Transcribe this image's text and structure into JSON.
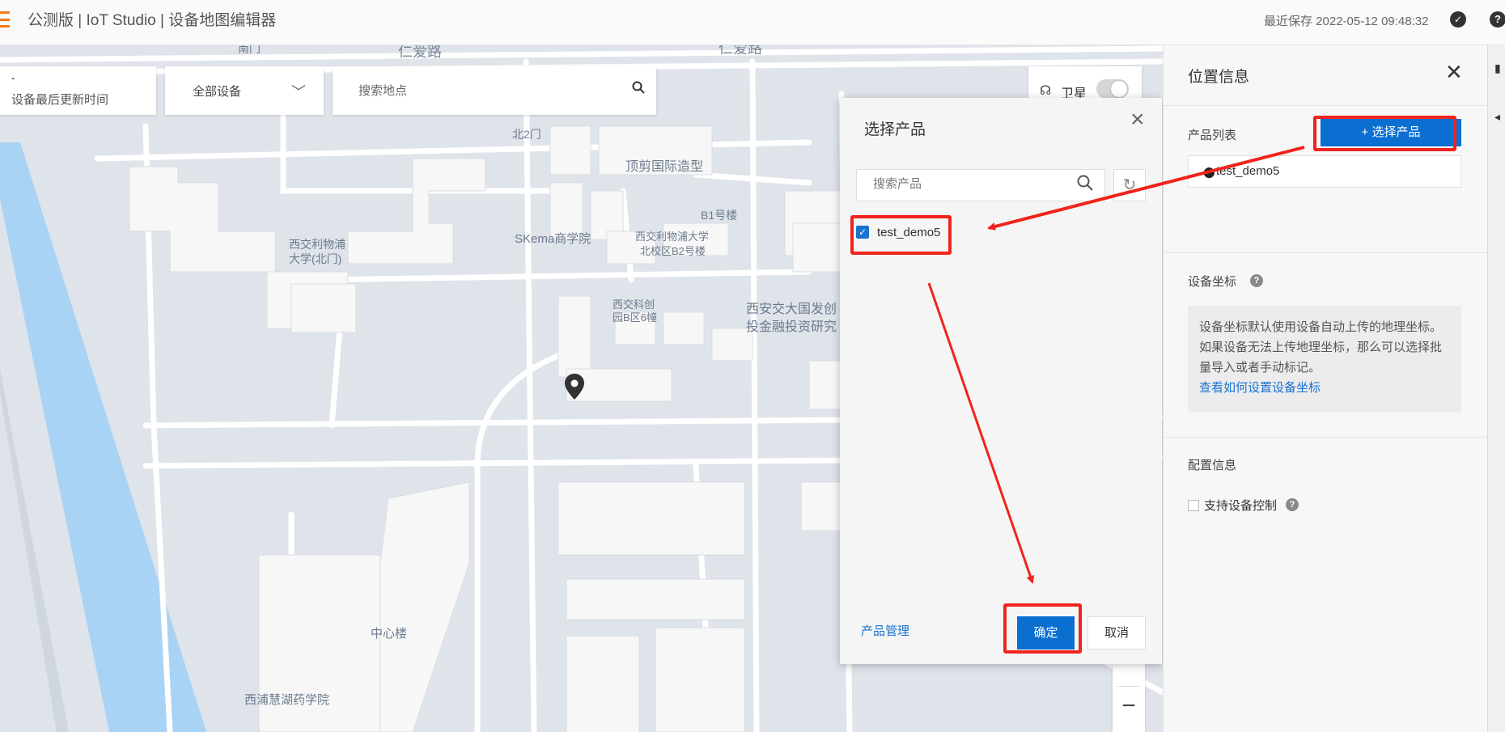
{
  "header": {
    "title": "公测版 | IoT Studio | 设备地图编辑器",
    "save_status": "最近保存 2022-05-12 09:48:32"
  },
  "map": {
    "time_filter": {
      "value": "-",
      "label": "设备最后更新时间"
    },
    "device_filter": {
      "value": "全部设备"
    },
    "search": {
      "placeholder": "搜索地点"
    },
    "satellite": {
      "label": "卫星",
      "on": false
    },
    "labels": {
      "road_1": "仁爱路",
      "road_2": "仁爱路",
      "south_gate": "南门",
      "north_gate": "北2门",
      "dingjian": "顶剪国际造型",
      "b1": "B1号楼",
      "xjtlu_north_line1": "西交利物浦",
      "xjtlu_north_line2": "大学(北门)",
      "skema": "SKema商学院",
      "b2_line1": "西交利物浦大学",
      "b2_line2": "北校区B2号楼",
      "kechuang_line1": "西交科创",
      "kechuang_line2": "园B区6幢",
      "xajd_line1": "西安交大国发创",
      "xajd_line2": "投金融投资研究",
      "center": "中心楼",
      "pharmacy": "西浦慧湖药学院"
    }
  },
  "dialog": {
    "title": "选择产品",
    "search_placeholder": "搜索产品",
    "products": [
      {
        "name": "test_demo5",
        "checked": true
      }
    ],
    "manage_link": "产品管理",
    "ok_label": "确定",
    "cancel_label": "取消"
  },
  "panel": {
    "title": "位置信息",
    "product_list_label": "产品列表",
    "select_product_label": "+ 选择产品",
    "selected_product": "test_demo5",
    "coord_label": "设备坐标",
    "coord_info": {
      "line1": "设备坐标默认使用设备自动上传的地理坐标。",
      "line2": "如果设备无法上传地理坐标，那么可以选择批",
      "line3": "量导入或者手动标记。",
      "link": "查看如何设置设备坐标"
    },
    "config_label": "配置信息",
    "support_control_label": "支持设备控制"
  },
  "colors": {
    "accent": "#0a6fd1",
    "annotation_red": "#f0241c",
    "brand_orange": "#f27a1a",
    "river": "#a9d3f5"
  }
}
